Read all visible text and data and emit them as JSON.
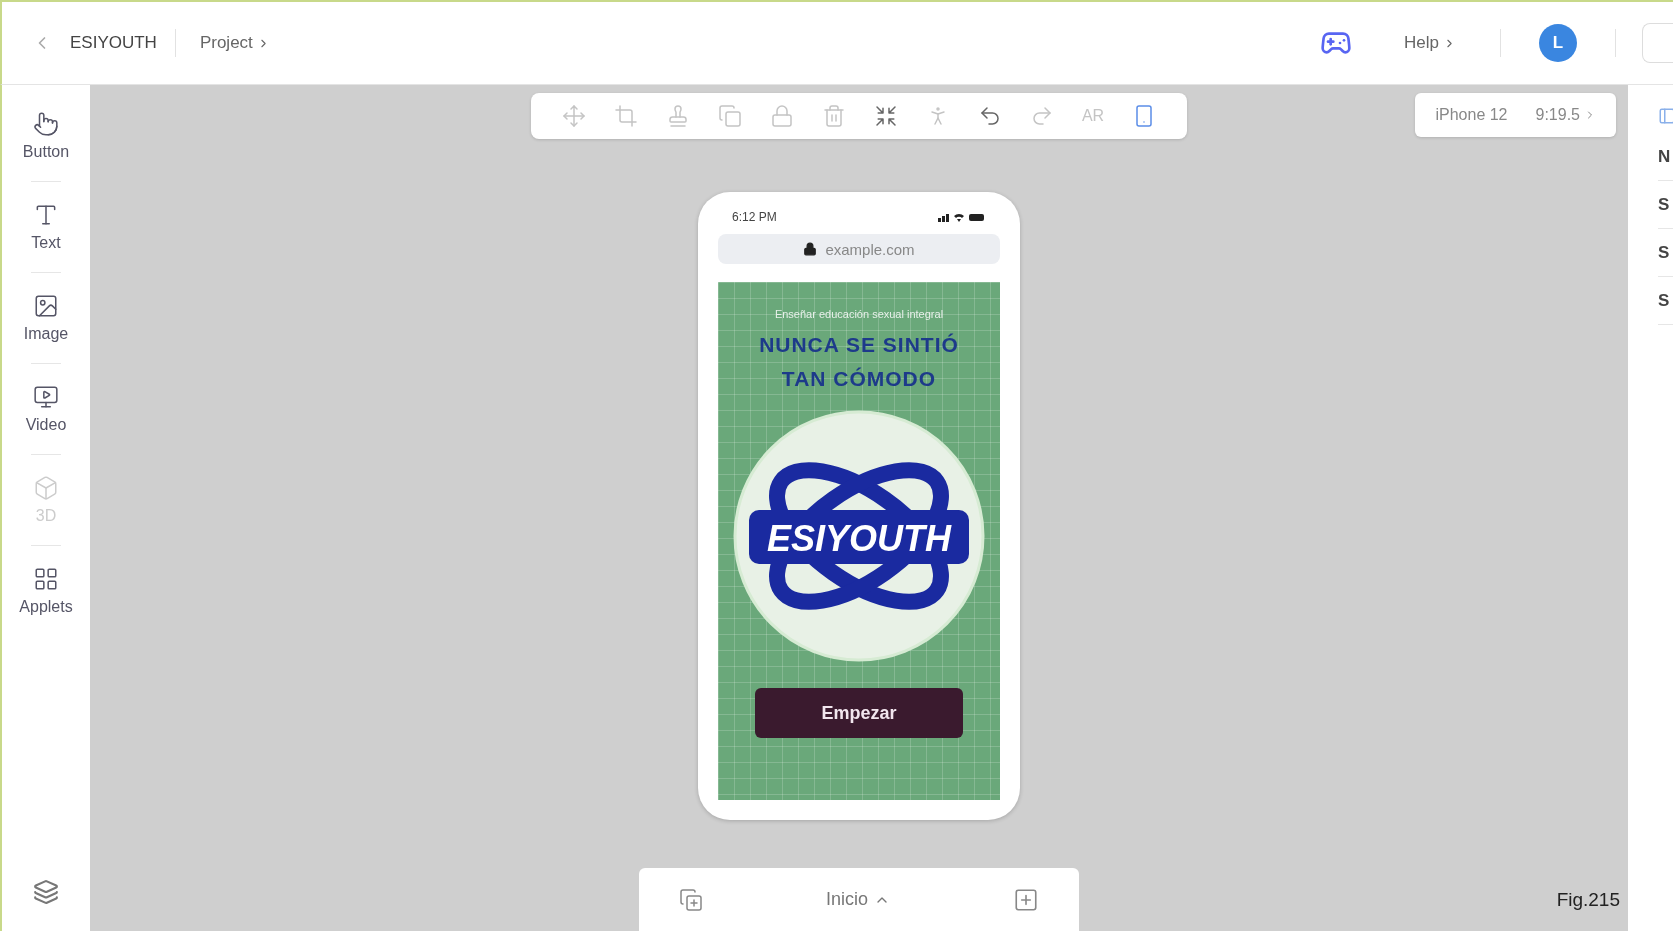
{
  "header": {
    "project_name": "ESIYOUTH",
    "breadcrumb": "Project",
    "help": "Help",
    "avatar_initial": "L"
  },
  "sidebar": {
    "items": [
      {
        "label": "Button",
        "kind": "button",
        "disabled": false
      },
      {
        "label": "Text",
        "kind": "text",
        "disabled": false
      },
      {
        "label": "Image",
        "kind": "image",
        "disabled": false
      },
      {
        "label": "Video",
        "kind": "video",
        "disabled": false
      },
      {
        "label": "3D",
        "kind": "cube",
        "disabled": true
      },
      {
        "label": "Applets",
        "kind": "applets",
        "disabled": false
      }
    ]
  },
  "toolbar": {
    "tools": [
      {
        "kind": "move",
        "disabled": true,
        "selected": false
      },
      {
        "kind": "crop",
        "disabled": true,
        "selected": false
      },
      {
        "kind": "stamp",
        "disabled": true,
        "selected": false
      },
      {
        "kind": "duplicate",
        "disabled": true,
        "selected": false
      },
      {
        "kind": "lock",
        "disabled": true,
        "selected": false
      },
      {
        "kind": "delete",
        "disabled": true,
        "selected": false
      },
      {
        "kind": "fit",
        "disabled": false,
        "selected": false
      },
      {
        "kind": "anchor",
        "disabled": true,
        "selected": false
      },
      {
        "kind": "undo",
        "disabled": false,
        "selected": false
      },
      {
        "kind": "redo",
        "disabled": true,
        "selected": false
      },
      {
        "kind": "text",
        "label": "AR",
        "disabled": true,
        "selected": false
      },
      {
        "kind": "device",
        "disabled": false,
        "selected": true
      }
    ]
  },
  "device": {
    "model": "iPhone 12",
    "ratio": "9:19.5"
  },
  "phone": {
    "time": "6:12 PM",
    "url": "example.com",
    "tagline": "Enseñar educación sexual integral",
    "headline": [
      "NUNCA SE SINTIÓ",
      "TAN CÓMODO"
    ],
    "logo_text": "ESIYOUTH",
    "cta": "Empezar"
  },
  "pages": {
    "current": "Inicio"
  },
  "right_panel": {
    "rows": [
      "N",
      "S",
      "S",
      "S"
    ]
  },
  "caption": "Fig.215"
}
